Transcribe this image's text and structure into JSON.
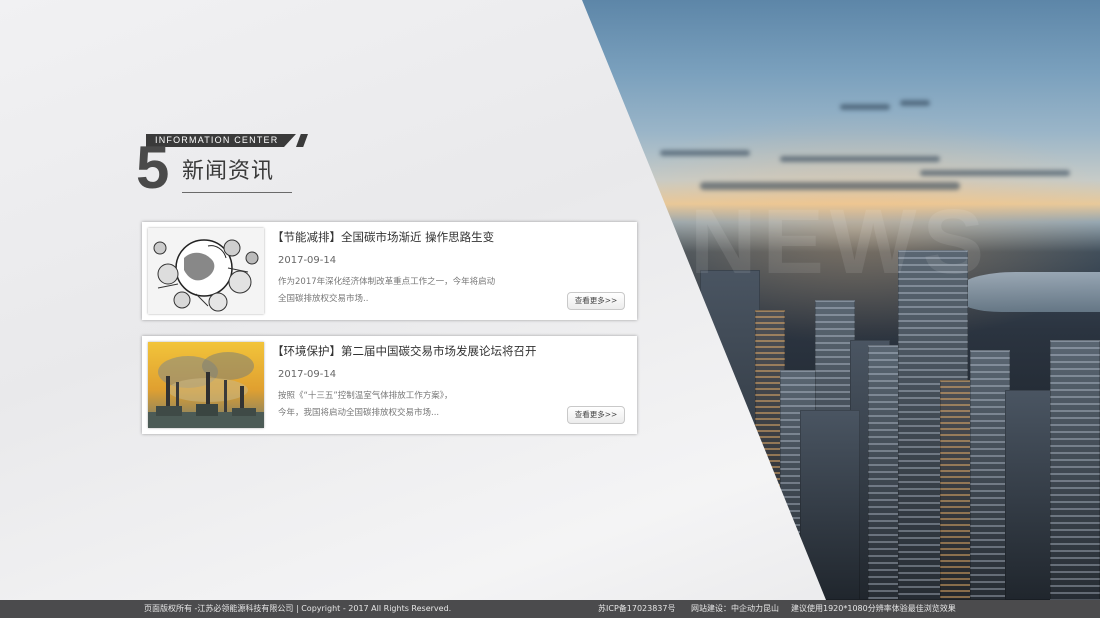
{
  "section": {
    "number": "5",
    "tag": "INFORMATION CENTER",
    "title": "新闻资讯"
  },
  "news": [
    {
      "title": "【节能减排】全国碳市场渐近 操作思路生变",
      "date": "2017-09-14",
      "desc_line1": "作为2017年深化经济体制改革重点工作之一，今年将启动",
      "desc_line2": "全国碳排放权交易市场..",
      "more": "查看更多>>",
      "thumb_icon": "globe-sketch-image"
    },
    {
      "title": "【环境保护】第二届中国碳交易市场发展论坛将召开",
      "date": "2017-09-14",
      "desc_line1": "按照《“十三五”控制温室气体排放工作方案》，",
      "desc_line2": "今年，我国将启动全国碳排放权交易市场...",
      "more": "查看更多>>",
      "thumb_icon": "factory-smoke-image"
    }
  ],
  "footer": {
    "copyright": "页面版权所有 -江苏必领能源科技有限公司 | Copyright - 2017 All Rights Reserved.",
    "icp": "苏ICP备17023837号",
    "builder": "网站建设：中企动力昆山",
    "advice": "建议使用1920*1080分辨率体验最佳浏览效果"
  },
  "backdrop": {
    "watermark": "NEWS"
  },
  "colors": {
    "footer_bg": "#4b4b4d",
    "heading": "#3a3a3a",
    "panel": "#efeff1"
  }
}
